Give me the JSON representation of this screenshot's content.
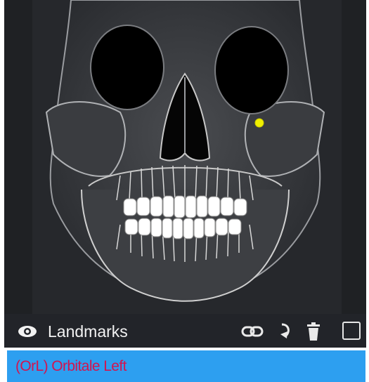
{
  "viewer": {
    "image_subject": "frontal skull x-ray with teeth",
    "landmark_color": "#f0f000"
  },
  "toolbar": {
    "title": "Landmarks",
    "icons": [
      "eye-icon",
      "link-icon",
      "rotate-icon",
      "trash-icon",
      "checkbox"
    ]
  },
  "selection": {
    "label": "(OrL) Orbitale Left",
    "background": "#2d9ff0",
    "text_color": "#d2144f"
  }
}
